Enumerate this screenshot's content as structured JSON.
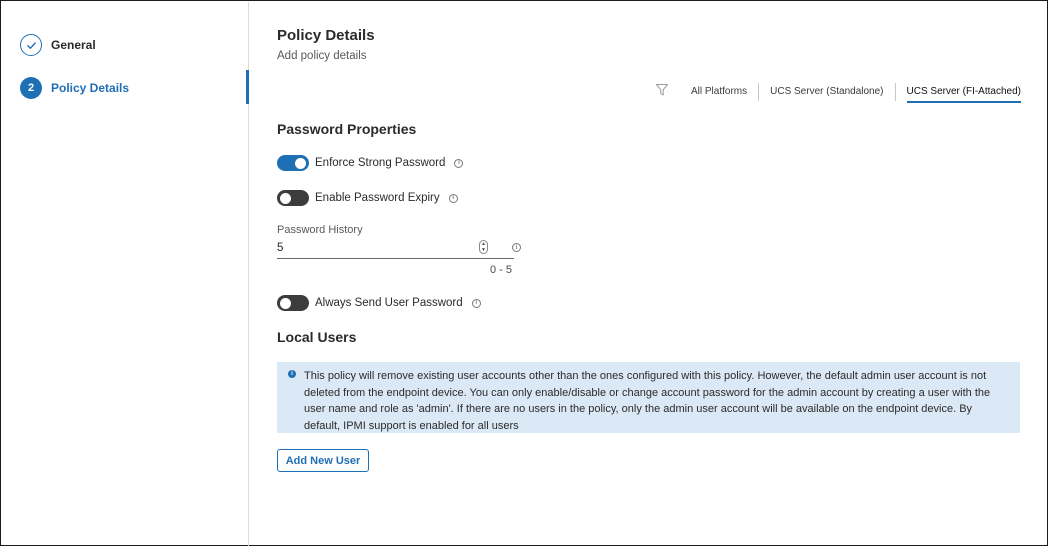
{
  "sidebar": {
    "steps": [
      {
        "label": "General",
        "state": "completed"
      },
      {
        "label": "Policy Details",
        "number": "2",
        "state": "active"
      }
    ]
  },
  "header": {
    "title": "Policy Details",
    "subtitle": "Add policy details"
  },
  "platforms": {
    "filter_icon": "filter-icon",
    "tabs": [
      "All Platforms",
      "UCS Server (Standalone)",
      "UCS Server (FI-Attached)"
    ],
    "selected": "UCS Server (FI-Attached)"
  },
  "password_properties": {
    "title": "Password Properties",
    "enforce_strong_password": {
      "label": "Enforce Strong Password",
      "enabled": true
    },
    "enable_password_expiry": {
      "label": "Enable Password Expiry",
      "enabled": false
    },
    "password_history": {
      "label": "Password History",
      "value": "5",
      "range": "0 - 5"
    },
    "always_send_user_password": {
      "label": "Always Send User Password",
      "enabled": false
    }
  },
  "local_users": {
    "title": "Local Users",
    "notice": "This policy will remove existing user accounts other than the ones configured with this policy. However, the default admin user account is not deleted from the endpoint device. You can only enable/disable or change account password for the admin account by creating a user with the user name and role as 'admin'. If there are no users in the policy, only the admin user account will be available on the endpoint device. By default, IPMI support is enabled for all users",
    "add_button": "Add New User"
  },
  "colors": {
    "accent": "#1f6fb5",
    "toggle_off": "#3c3c3c",
    "notice_bg": "#dbe8f5"
  }
}
